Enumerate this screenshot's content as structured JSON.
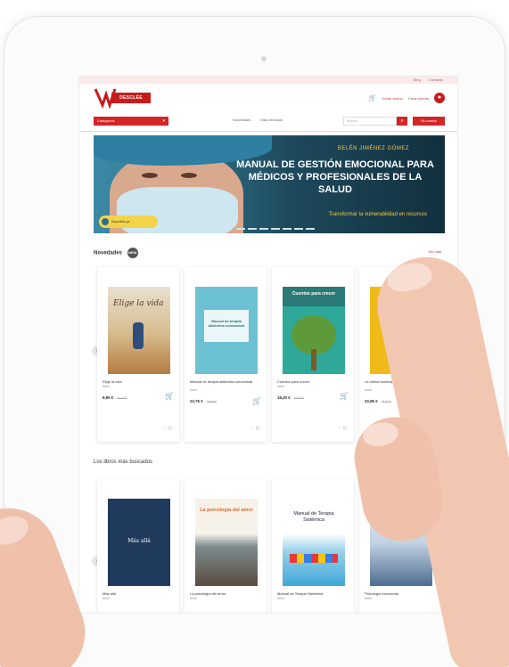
{
  "header": {
    "top_links": [
      "Blog",
      "Contacto"
    ],
    "logo_text": "DESCLÉE",
    "account_links": [
      "Iniciar sesión",
      "Crear cuenta"
    ]
  },
  "nav": {
    "category_select": "Categorías",
    "links": [
      "Novedades",
      "Más vendidos"
    ],
    "search_placeholder": "Buscar...",
    "account_button": "Mi cuenta"
  },
  "banner": {
    "author": "BELÉN JIMÉNEZ GÓMEZ",
    "title": "MANUAL DE GESTIÓN EMOCIONAL PARA MÉDICOS Y PROFESIONALES DE LA SALUD",
    "subtitle": "Transformar la vulnerabilidad en recursos",
    "badge": "Disponible ya"
  },
  "sections": [
    {
      "title": "Novedades",
      "count": "NEW",
      "link": "Ver más",
      "books": [
        {
          "cover_title": "Elige la vida",
          "title": "Elige la vida",
          "sub": "Autor",
          "price": "9,90 €",
          "old": "11,00 €"
        },
        {
          "cover_title": "Manual de terapia dialéctica conductual",
          "title": "Manual de terapia dialéctica conductual",
          "sub": "Autor",
          "price": "22,75 €",
          "old": "25,00 €"
        },
        {
          "cover_title": "Cuentos para crecer",
          "title": "Cuentos para crecer",
          "sub": "Autor",
          "price": "15,20 €",
          "old": "16,00 €"
        },
        {
          "cover_title": "",
          "title": "La última frontera",
          "sub": "Autor",
          "price": "22,95 €",
          "old": "24,20 €"
        }
      ]
    },
    {
      "title": "Los libros más buscados",
      "count": "",
      "link": "Ver más",
      "books": [
        {
          "cover_title": "Más allá",
          "title": "Más allá",
          "sub": "Autor",
          "price": "",
          "old": ""
        },
        {
          "cover_title": "La psicología del amor",
          "title": "La psicología del amor",
          "sub": "Autor",
          "price": "",
          "old": ""
        },
        {
          "cover_title": "Manual de Terapia Sistémica",
          "title": "Manual de Terapia Sistémica",
          "sub": "Autor",
          "price": "",
          "old": ""
        },
        {
          "cover_title": "",
          "title": "Psicología emocional",
          "sub": "Autor",
          "price": "",
          "old": ""
        }
      ]
    }
  ],
  "colors": {
    "brand": "#c71c1c",
    "accent": "#f2c94c"
  },
  "icons": [
    "cart-icon",
    "user-icon",
    "search-icon",
    "chevron-down-icon",
    "arrow-left-icon",
    "add-to-cart-icon"
  ]
}
